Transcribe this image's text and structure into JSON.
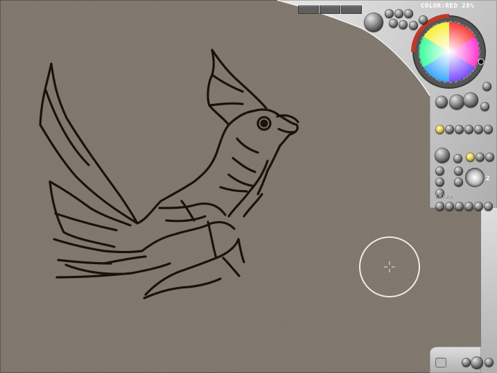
{
  "color_readout": "COLOR:RED 28%",
  "brush_size": "2",
  "panels": {
    "layer_label": "LAYER"
  },
  "icons": [
    "color-wheel-icon",
    "brush-preview-icon",
    "crosshair-icon",
    "mixer-icon"
  ],
  "colors": {
    "canvas": "#7a7167",
    "chrome": "#c7c7c7",
    "ink": "#1c120c",
    "cursor": "#f0ece6"
  }
}
